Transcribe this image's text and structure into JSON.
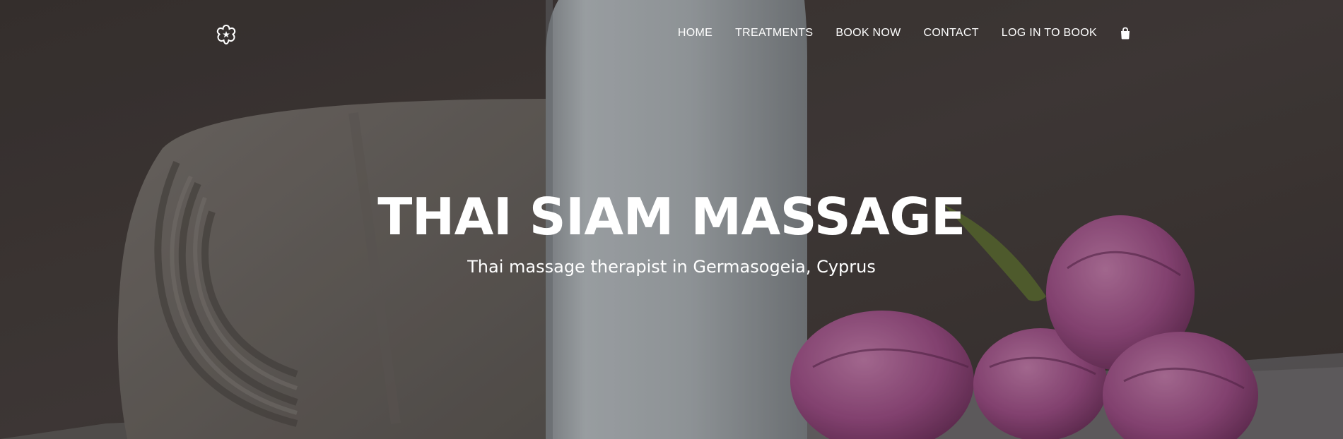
{
  "header": {
    "logo_icon": "flower-icon",
    "nav": {
      "home": "HOME",
      "treatments": "TREATMENTS",
      "book_now": "BOOK NOW",
      "contact": "CONTACT",
      "log_in": "LOG IN TO BOOK"
    },
    "cart_icon": "shopping-bag-icon"
  },
  "hero": {
    "title": "THAI SIAM MASSAGE",
    "subtitle": "Thai massage therapist in Germasogeia, Cyprus"
  },
  "colors": {
    "text": "#ffffff",
    "background": "#3f3a38",
    "towel": "#6e6a65",
    "bottle": "#a9b0b4",
    "tulip": "#9c4f86",
    "leaf": "#5b6b33"
  }
}
